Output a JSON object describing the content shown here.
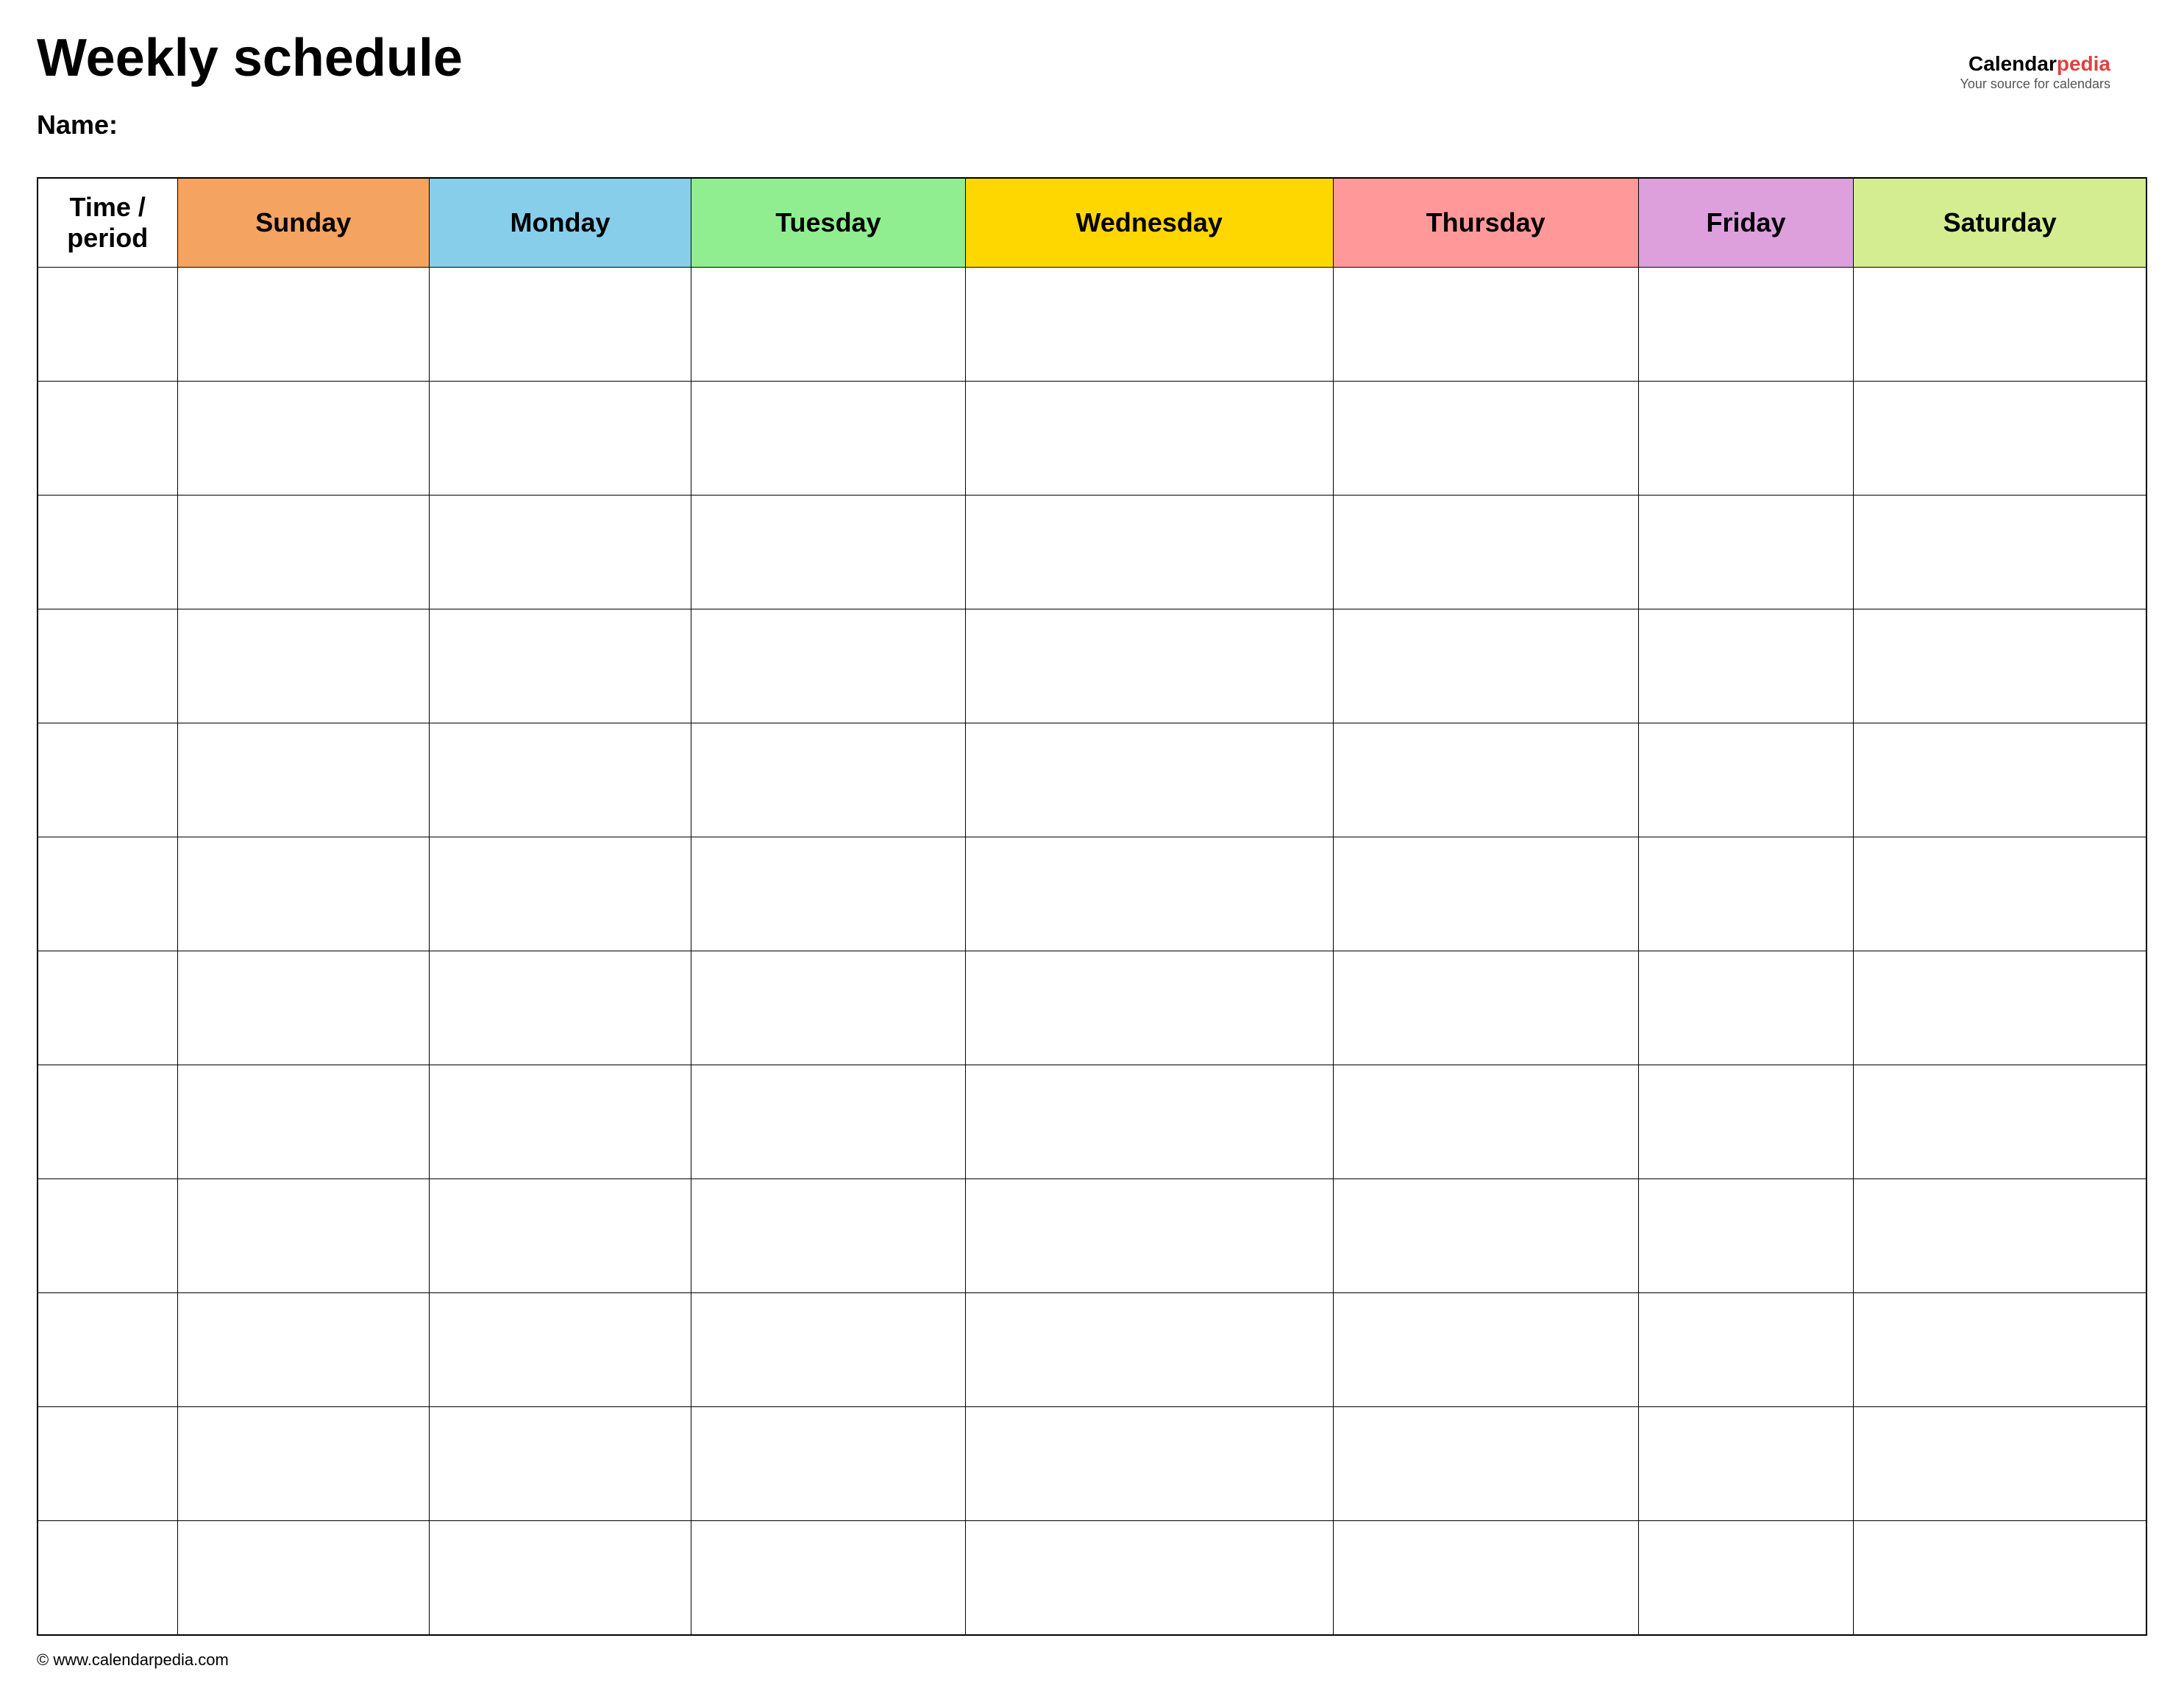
{
  "page": {
    "title": "Weekly schedule",
    "name_label": "Name:",
    "footer": "© www.calendarpedia.com"
  },
  "logo": {
    "calendar": "Calendar",
    "pedia": "pedia",
    "subtitle": "Your source for calendars"
  },
  "table": {
    "headers": [
      {
        "label": "Time / period",
        "class": "header-time"
      },
      {
        "label": "Sunday",
        "class": "header-sunday"
      },
      {
        "label": "Monday",
        "class": "header-monday"
      },
      {
        "label": "Tuesday",
        "class": "header-tuesday"
      },
      {
        "label": "Wednesday",
        "class": "header-wednesday"
      },
      {
        "label": "Thursday",
        "class": "header-thursday"
      },
      {
        "label": "Friday",
        "class": "header-friday"
      },
      {
        "label": "Saturday",
        "class": "header-saturday"
      }
    ],
    "row_count": 12
  }
}
